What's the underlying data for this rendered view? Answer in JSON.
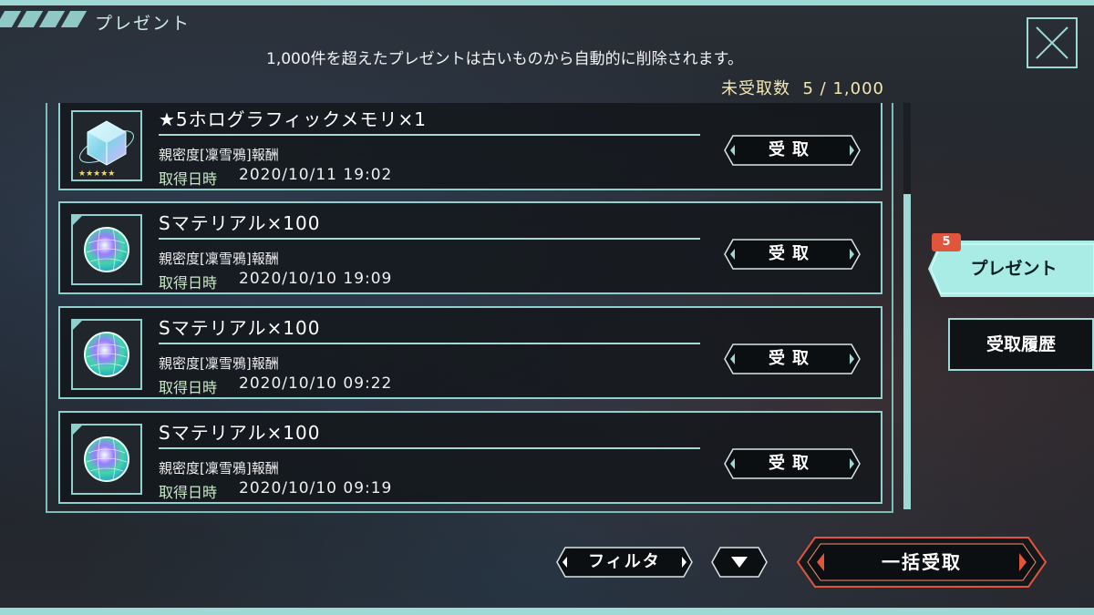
{
  "header": {
    "title": "プレゼント"
  },
  "notice": "1,000件を超えたプレゼントは古いものから自動的に削除されます。",
  "unreceived": {
    "label": "未受取数",
    "value": "5 / 1,000"
  },
  "items": [
    {
      "name": "★5ホログラフィックメモリ×1",
      "source": "親密度[凜雪鴉]報酬",
      "date_label": "取得日時",
      "date": "2020/10/11 19:02",
      "button": "受取",
      "icon": "holographic-cube-icon"
    },
    {
      "name": "Sマテリアル×100",
      "source": "親密度[凜雪鴉]報酬",
      "date_label": "取得日時",
      "date": "2020/10/10 19:09",
      "button": "受取",
      "icon": "material-orb-icon"
    },
    {
      "name": "Sマテリアル×100",
      "source": "親密度[凜雪鴉]報酬",
      "date_label": "取得日時",
      "date": "2020/10/10 09:22",
      "button": "受取",
      "icon": "material-orb-icon"
    },
    {
      "name": "Sマテリアル×100",
      "source": "親密度[凜雪鴉]報酬",
      "date_label": "取得日時",
      "date": "2020/10/10 09:19",
      "button": "受取",
      "icon": "material-orb-icon"
    }
  ],
  "tabs": {
    "present": "プレゼント",
    "present_badge": "5",
    "history": "受取履歴"
  },
  "footer": {
    "filter": "フィルタ",
    "bulk_receive": "一括受取"
  },
  "colors": {
    "accent": "#9fd9d6",
    "badge": "#e0553c",
    "bulk_border": "#e0553c"
  }
}
